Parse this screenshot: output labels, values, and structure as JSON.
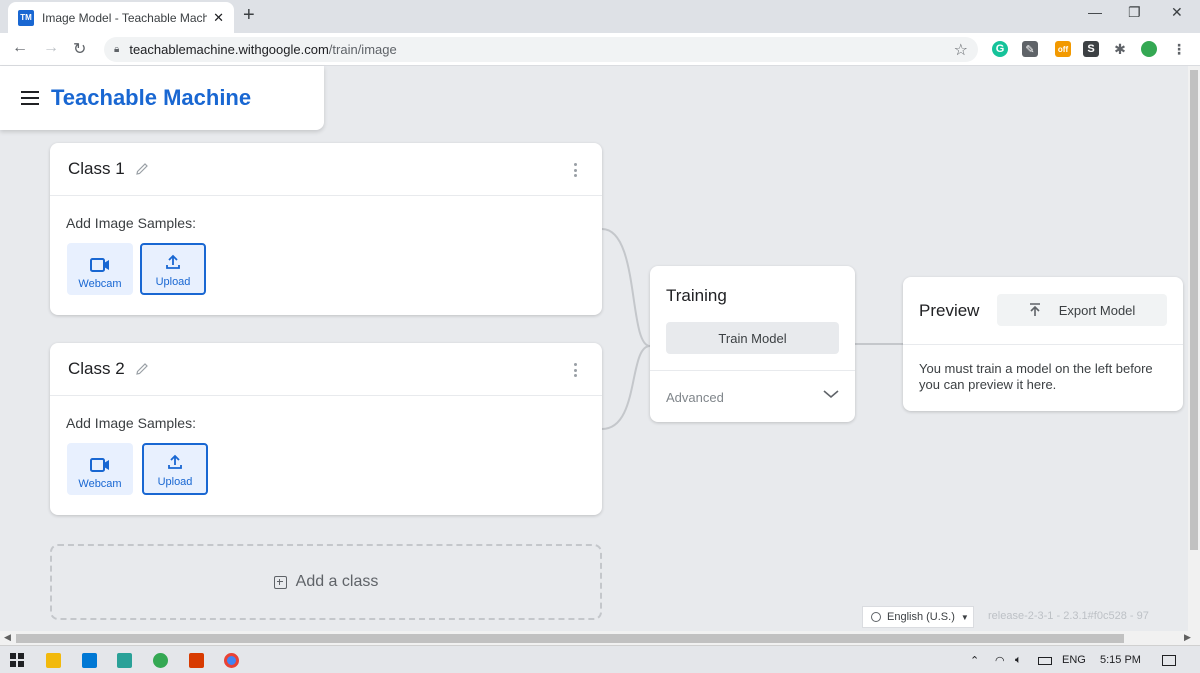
{
  "browser": {
    "tab_title": "Image Model - Teachable Machi",
    "favicon_text": "TM",
    "url_host": "teachablemachine.withgoogle.com",
    "url_path": "/train/image",
    "extension_off_label": "off"
  },
  "header": {
    "brand": "Teachable Machine"
  },
  "classes": [
    {
      "name": "Class 1",
      "samples_label": "Add Image Samples:",
      "webcam_label": "Webcam",
      "upload_label": "Upload"
    },
    {
      "name": "Class 2",
      "samples_label": "Add Image Samples:",
      "webcam_label": "Webcam",
      "upload_label": "Upload"
    }
  ],
  "add_class": {
    "label": "Add a class"
  },
  "training": {
    "title": "Training",
    "button": "Train Model",
    "advanced": "Advanced"
  },
  "preview": {
    "title": "Preview",
    "export_button": "Export Model",
    "message": "You must train a model on the left before you can preview it here."
  },
  "footer": {
    "language": "English (U.S.)",
    "release": "release-2-3-1 - 2.3.1#f0c528 - 97"
  },
  "taskbar": {
    "language": "ENG",
    "time": "5:15 PM"
  },
  "colors": {
    "brand": "#1967d2",
    "sample_button_bg": "#e8f0fe",
    "page_bg": "#e8eaed"
  }
}
